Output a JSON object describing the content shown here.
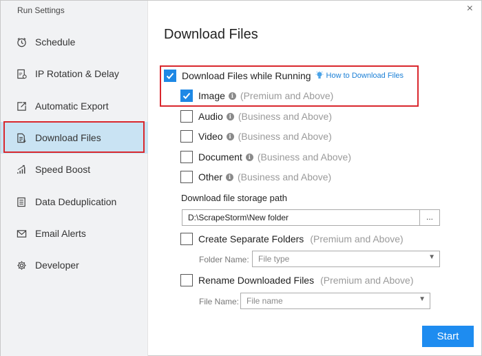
{
  "window": {
    "title": "Run Settings",
    "close_glyph": "×"
  },
  "sidebar": {
    "items": [
      {
        "label": "Schedule",
        "icon": "clock-icon"
      },
      {
        "label": "IP Rotation & Delay",
        "icon": "ip-document-icon"
      },
      {
        "label": "Automatic Export",
        "icon": "export-icon"
      },
      {
        "label": "Download Files",
        "icon": "download-file-icon",
        "active": true
      },
      {
        "label": "Speed Boost",
        "icon": "signal-bars-icon"
      },
      {
        "label": "Data Deduplication",
        "icon": "dedup-document-icon"
      },
      {
        "label": "Email Alerts",
        "icon": "envelope-icon"
      },
      {
        "label": "Developer",
        "icon": "gear-icon"
      }
    ]
  },
  "main": {
    "title": "Download Files",
    "download_while_running": {
      "label": "Download Files while Running",
      "checked": true
    },
    "help_link": "How to Download Files",
    "file_types": [
      {
        "label": "Image",
        "tier": "(Premium and Above)",
        "checked": true
      },
      {
        "label": "Audio",
        "tier": "(Business and Above)",
        "checked": false
      },
      {
        "label": "Video",
        "tier": "(Business and Above)",
        "checked": false
      },
      {
        "label": "Document",
        "tier": "(Business and Above)",
        "checked": false
      },
      {
        "label": "Other",
        "tier": "(Business and Above)",
        "checked": false
      }
    ],
    "storage_path_label": "Download file storage path",
    "storage_path_value": "D:\\ScrapeStorm\\New folder",
    "browse_label": "...",
    "create_folders": {
      "label": "Create Separate Folders",
      "tier": "(Premium and Above)",
      "checked": false
    },
    "folder_name_label": "Folder Name:",
    "folder_name_placeholder": "File type",
    "rename_files": {
      "label": "Rename Downloaded Files",
      "tier": "(Premium and Above)",
      "checked": false
    },
    "file_name_label": "File Name:",
    "file_name_placeholder": "File name",
    "start_label": "Start",
    "info_glyph": "i"
  },
  "colors": {
    "accent": "#1e88e5",
    "highlight_border": "#d9262c",
    "active_nav_bg": "#c9e3f3",
    "sidebar_bg": "#f1f2f4"
  }
}
